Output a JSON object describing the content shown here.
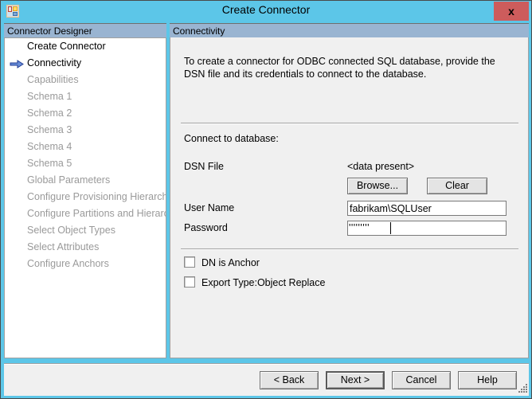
{
  "window": {
    "title": "Create Connector",
    "icon": "app-grid-icon",
    "close_label": "x",
    "titlebar_color": "#5cc6e8",
    "close_color": "#cd5c5c"
  },
  "sidebar": {
    "header": "Connector Designer",
    "current_marker": "arrow-right-icon",
    "items": [
      {
        "label": "Create Connector",
        "state": "done"
      },
      {
        "label": "Connectivity",
        "state": "current"
      },
      {
        "label": "Capabilities",
        "state": "disabled"
      },
      {
        "label": "Schema 1",
        "state": "disabled"
      },
      {
        "label": "Schema 2",
        "state": "disabled"
      },
      {
        "label": "Schema 3",
        "state": "disabled"
      },
      {
        "label": "Schema 4",
        "state": "disabled"
      },
      {
        "label": "Schema 5",
        "state": "disabled"
      },
      {
        "label": "Global Parameters",
        "state": "disabled"
      },
      {
        "label": "Configure Provisioning Hierarchy",
        "state": "disabled"
      },
      {
        "label": "Configure Partitions and Hierarchies",
        "state": "disabled"
      },
      {
        "label": "Select Object Types",
        "state": "disabled"
      },
      {
        "label": "Select Attributes",
        "state": "disabled"
      },
      {
        "label": "Configure Anchors",
        "state": "disabled"
      }
    ]
  },
  "content": {
    "header": "Connectivity",
    "intro": "To create a connector for ODBC connected SQL database, provide the DSN file and its credentials to connect to the database.",
    "section_label": "Connect to database:",
    "fields": {
      "dsn_label": "DSN File",
      "dsn_value": "<data present>",
      "browse_label": "Browse...",
      "clear_label": "Clear",
      "user_label": "User Name",
      "user_value": "fabrikam\\SQLUser",
      "password_label": "Password",
      "password_mask": "'''''''''"
    },
    "checkboxes": [
      {
        "label": "DN is Anchor",
        "checked": false
      },
      {
        "label": "Export Type:Object Replace",
        "checked": false
      }
    ]
  },
  "footer": {
    "back_label": "< Back",
    "next_label": "Next  >",
    "cancel_label": "Cancel",
    "help_label": "Help"
  }
}
